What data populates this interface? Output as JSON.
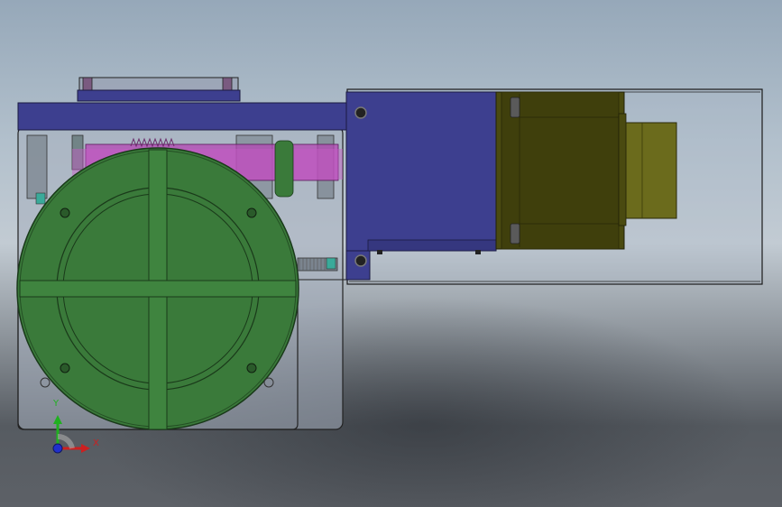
{
  "viewport": {
    "axes": {
      "x_label": "X",
      "y_label": "Y"
    },
    "colors": {
      "housing_blue": "#3d3f8f",
      "turntable_green": "#3a7a3a",
      "motor_olive": "#4a4a10",
      "shaft_yellow": "#6b6b1c",
      "rack_magenta": "#b040b0",
      "axis_x": "#cc2020",
      "axis_y": "#20b020",
      "axis_z": "#2030cc"
    },
    "icons": [
      "coordinate-triad-icon"
    ]
  }
}
